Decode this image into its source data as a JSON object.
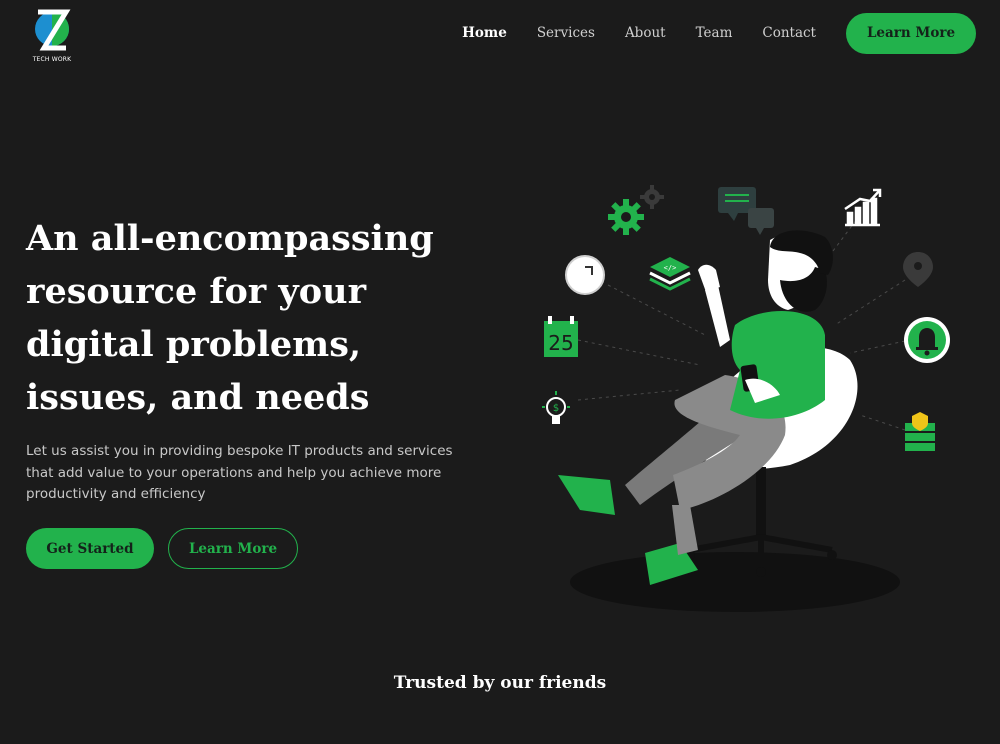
{
  "brand": {
    "logo_text": "TECH WORK"
  },
  "nav": {
    "links": [
      "Home",
      "Services",
      "About",
      "Team",
      "Contact"
    ],
    "active": "Home",
    "cta_label": "Learn More"
  },
  "hero": {
    "title": "An all-encompassing resource for your digital problems, issues, and needs",
    "subtitle": "Let us assist you in providing bespoke IT products and services that add value to your operations and help you achieve more productivity and efficiency",
    "primary_button": "Get Started",
    "secondary_button": "Learn More"
  },
  "illustration": {
    "calendar_day": "25",
    "icons": [
      "gear-icon",
      "chat-icon",
      "chart-icon",
      "clock-icon",
      "code-layers-icon",
      "location-pin-icon",
      "calendar-icon",
      "bell-icon",
      "lightbulb-icon",
      "server-shield-icon"
    ]
  },
  "trusted": {
    "heading": "Trusted by our friends"
  },
  "colors": {
    "accent": "#22b24c",
    "background": "#1b1b1b",
    "text": "#ffffff",
    "muted": "#c8c8c8"
  }
}
